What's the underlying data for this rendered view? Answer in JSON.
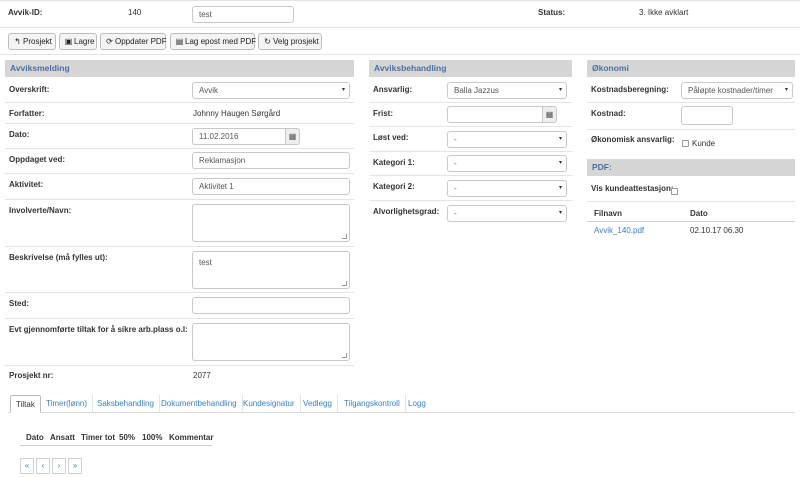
{
  "header": {
    "avvik_id_label": "Avvik-ID:",
    "avvik_id_value": "140",
    "title_input_value": "test",
    "status_label": "Status:",
    "status_value": "3. Ikke avklart"
  },
  "toolbar": {
    "prosjekt_label": "Prosjekt",
    "lagre_label": "Lagre",
    "oppdater_pdf_label": "Oppdater PDF",
    "lag_epost_label": "Lag epost med PDF",
    "velg_prosjekt_label": "Velg prosjekt"
  },
  "avviksmelding": {
    "title": "Avviksmelding",
    "overskrift_label": "Overskrift:",
    "overskrift_value": "Avvik",
    "forfatter_label": "Forfatter:",
    "forfatter_value": "Johnny Haugen Sørgård",
    "dato_label": "Dato:",
    "dato_value": "11.02.2016",
    "oppdaget_label": "Oppdaget ved:",
    "oppdaget_value": "Reklamasjon",
    "aktivitet_label": "Aktivitet:",
    "aktivitet_value": "Aktivitet 1",
    "involverte_label": "Involverte/Navn:",
    "involverte_value": "",
    "beskrivelse_label": "Beskrivelse (må fylles ut):",
    "beskrivelse_value": "test",
    "sted_label": "Sted:",
    "sted_value": "",
    "tiltak_label": "Evt gjennomførte tiltak for å sikre arb.plass o.l:",
    "tiltak_value": "",
    "prosjekt_nr_label": "Prosjekt nr:",
    "prosjekt_nr_value": "2077"
  },
  "avviksbehandling": {
    "title": "Avviksbehandling",
    "ansvarlig_label": "Ansvarlig:",
    "ansvarlig_value": "Balla Jazzus",
    "frist_label": "Frist:",
    "frist_value": "",
    "lost_ved_label": "Løst ved:",
    "lost_ved_value": "-",
    "kategori1_label": "Kategori 1:",
    "kategori1_value": "-",
    "kategori2_label": "Kategori 2:",
    "kategori2_value": "-",
    "alvorlighet_label": "Alvorlighetsgrad:",
    "alvorlighet_value": "-"
  },
  "okonomi": {
    "title": "Økonomi",
    "kostnadsberegning_label": "Kostnadsberegning:",
    "kostnadsberegning_value": "Påløpte kostnader/timer",
    "kostnad_label": "Kostnad:",
    "kostnad_value": "",
    "okonomisk_ansvarlig_label": "Økonomisk ansvarlig:",
    "kunde_label": "Kunde"
  },
  "pdf": {
    "title": "PDF:",
    "vis_kundeattestasjon_label": "Vis kundeattestasjon:",
    "col_filnavn": "Filnavn",
    "col_dato": "Dato",
    "file_name": "Avvik_140.pdf",
    "file_date": "02.10.17 06.30"
  },
  "tabs": [
    "Tiltak",
    "Timer(lønn)",
    "Saksbehandling",
    "Dokumentbehandling",
    "Kundesignatur",
    "Vedlegg",
    "Tilgangskontroll",
    "Logg"
  ],
  "tiltak_table": {
    "headers": [
      "Dato",
      "Ansatt",
      "Timer tot",
      "50%",
      "100%",
      "Kommentar"
    ]
  },
  "pagination": [
    "«",
    "‹",
    "›",
    "»"
  ],
  "icons": {
    "calendar": "calendar-icon",
    "dropdown": "chevron-down-icon",
    "back": "back-arrow-icon",
    "save": "floppy-icon",
    "refresh": "refresh-icon",
    "email": "envelope-icon",
    "select": "rotate-icon"
  },
  "colors": {
    "section_header_bg": "#d6d6d6",
    "section_header_text": "#4a6fa5",
    "link": "#3a7fc4"
  }
}
